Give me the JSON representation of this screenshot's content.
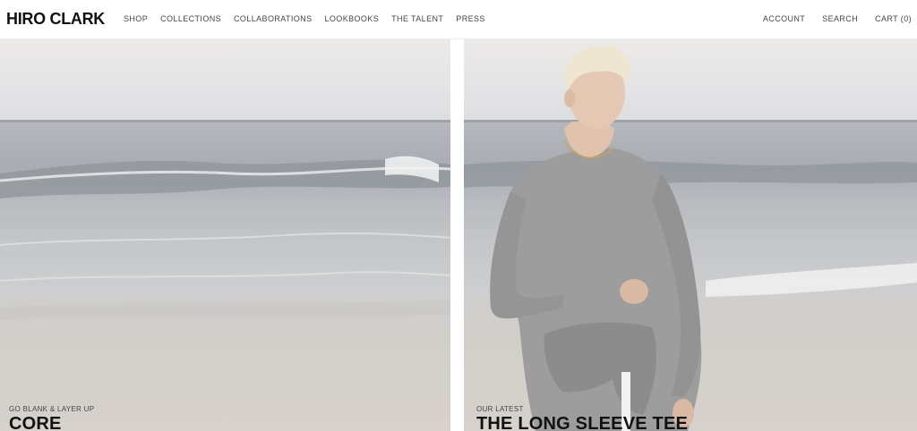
{
  "brand": {
    "logo": "HIRO CLARK"
  },
  "nav": {
    "items": [
      "SHOP",
      "COLLECTIONS",
      "COLLABORATIONS",
      "LOOKBOOKS",
      "THE TALENT",
      "PRESS"
    ]
  },
  "utility": {
    "account": "ACCOUNT",
    "search": "SEARCH",
    "cart": "CART (0)"
  },
  "hero": {
    "left": {
      "kicker": "GO BLANK & LAYER UP",
      "title": "CORE"
    },
    "right": {
      "kicker": "OUR LATEST",
      "title": "THE LONG SLEEVE TEE"
    }
  },
  "colors": {
    "background": "#ffffff",
    "text": "#111111",
    "nav_text": "#444444",
    "sea": "#aeb2b7",
    "sand": "#d3cfca",
    "shirt": "#9c9c9c"
  }
}
